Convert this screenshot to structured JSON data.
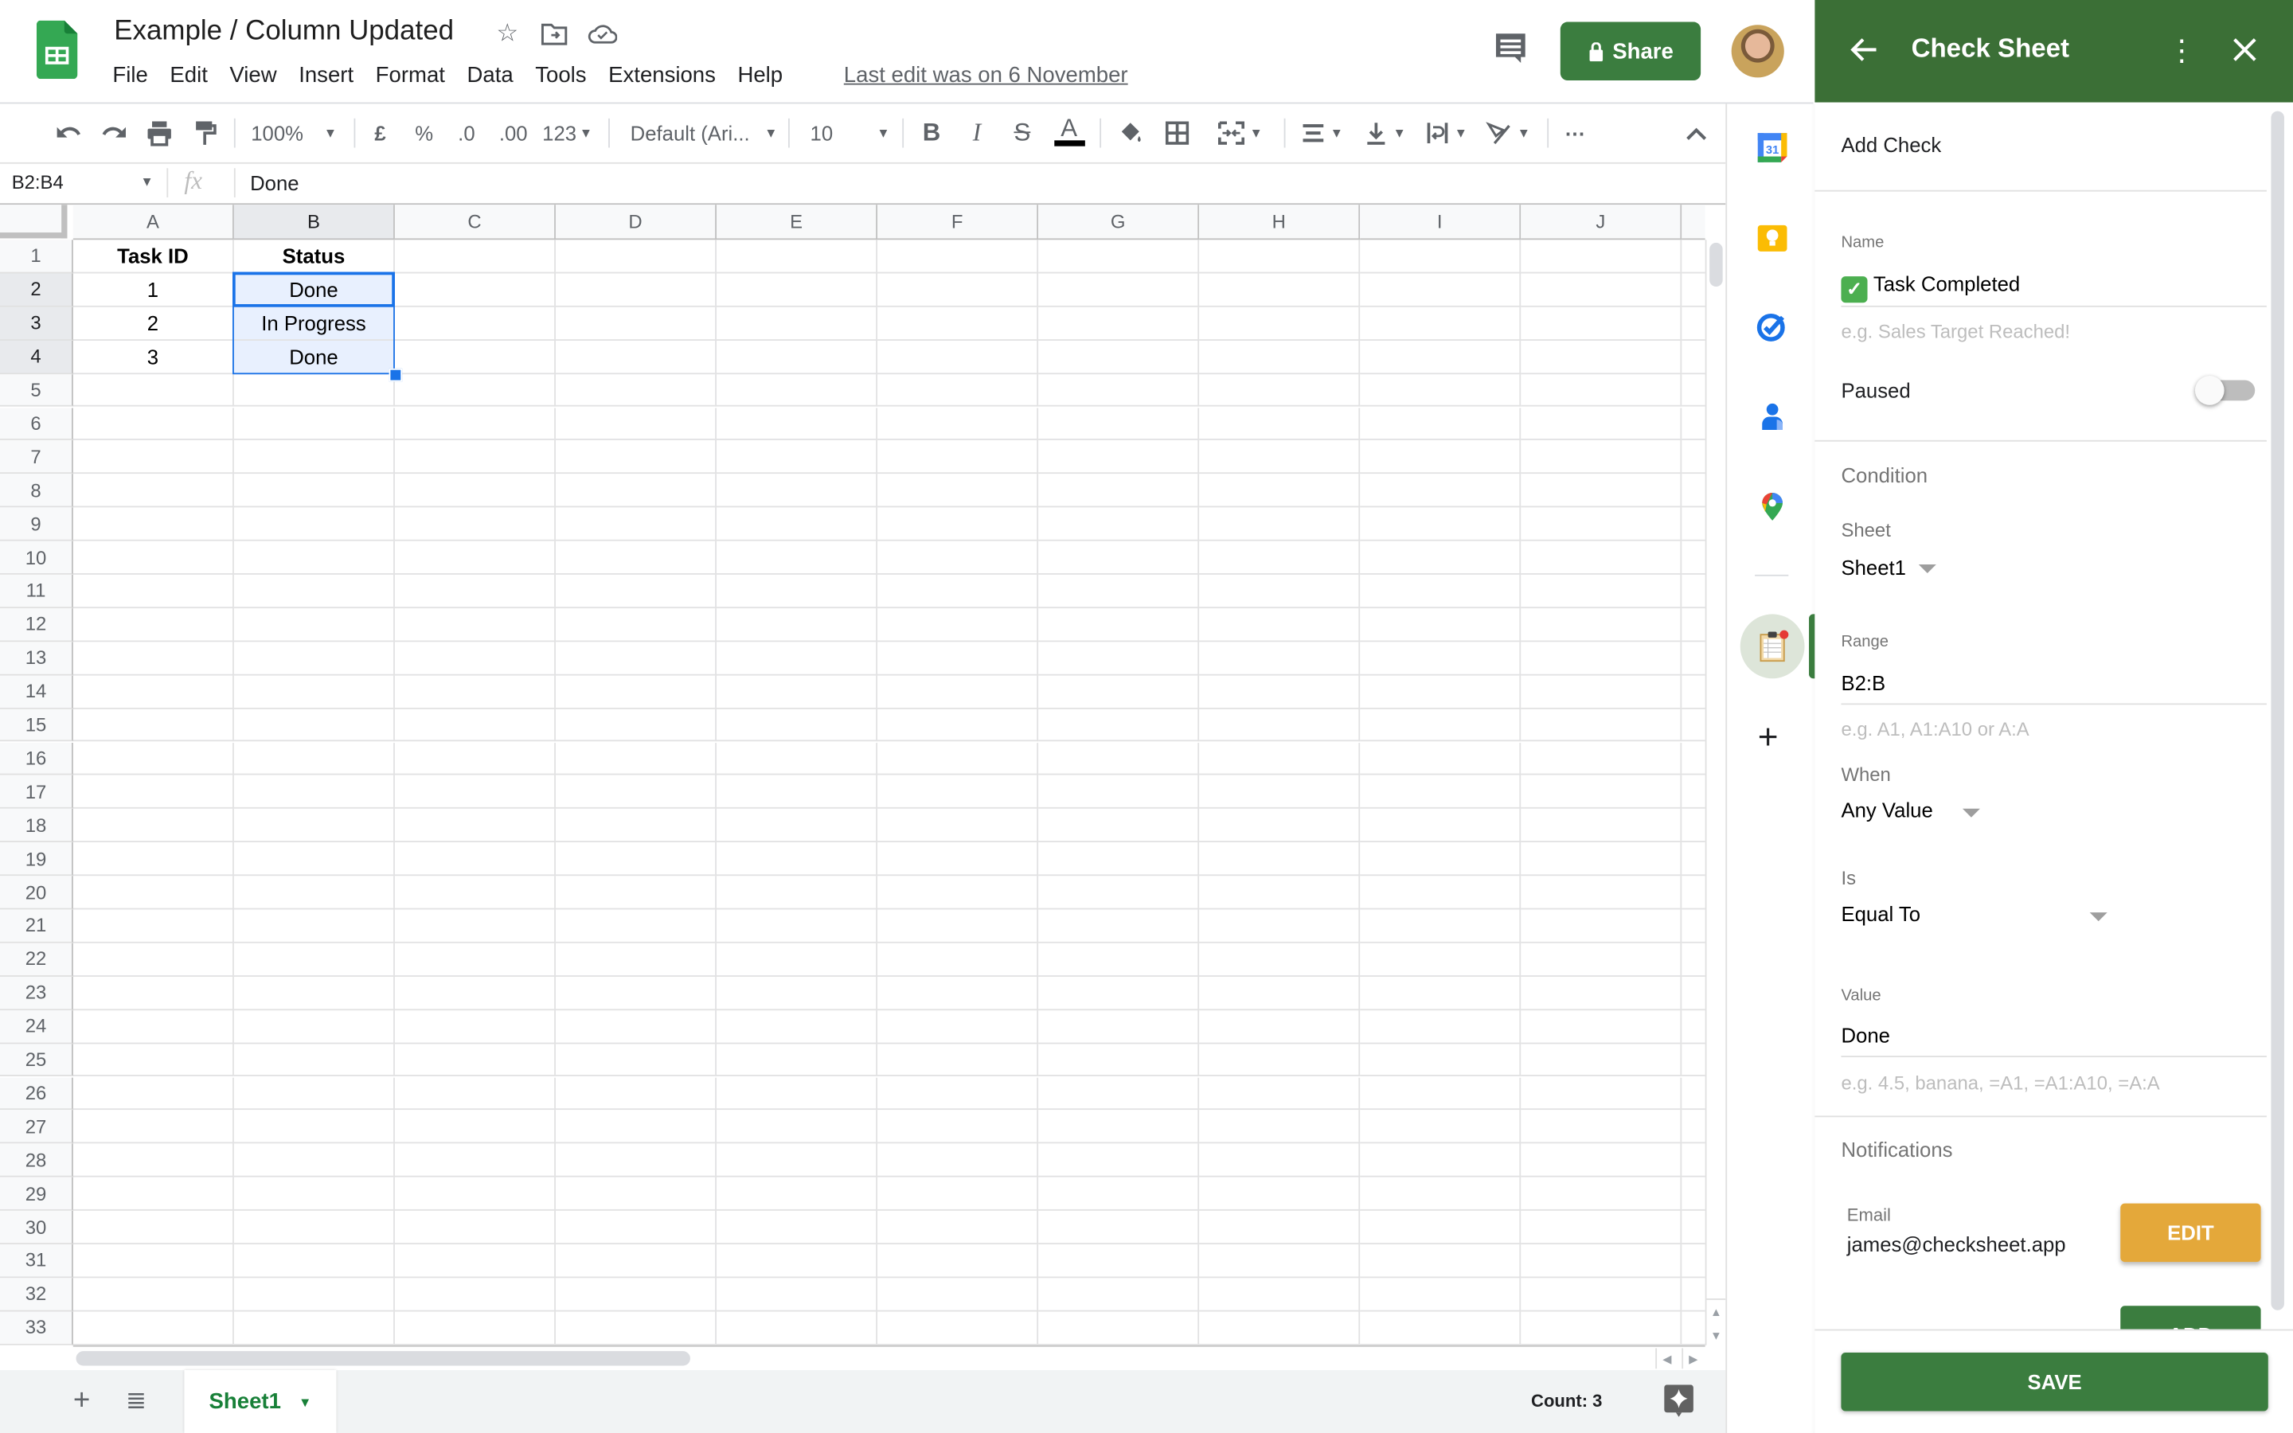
{
  "app": {
    "document_title": "Example / Column Updated",
    "menu": [
      "File",
      "Edit",
      "View",
      "Insert",
      "Format",
      "Data",
      "Tools",
      "Extensions",
      "Help"
    ],
    "last_edit": "Last edit was on 6 November",
    "share_label": "Share",
    "brand_color": "#3b7d3f"
  },
  "toolbar": {
    "zoom": "100%",
    "currency": "£",
    "percent": "%",
    "decrease_decimal": ".0",
    "increase_decimal": ".00",
    "number_format": "123",
    "font": "Default (Ari...",
    "font_size": "10",
    "bold": "B",
    "italic": "I",
    "strikethrough": "S",
    "text_color": "A",
    "more": "⋯"
  },
  "formula_bar": {
    "name_box": "B2:B4",
    "fx": "fx",
    "value": "Done"
  },
  "grid": {
    "columns": [
      "A",
      "B",
      "C",
      "D",
      "E",
      "F",
      "G",
      "H",
      "I",
      "J"
    ],
    "selected_column": "B",
    "row_count": 33,
    "selected_rows": [
      2,
      3,
      4
    ],
    "rows": [
      [
        "Task ID",
        "Status"
      ],
      [
        "1",
        "Done"
      ],
      [
        "2",
        "In Progress"
      ],
      [
        "3",
        "Done"
      ]
    ],
    "selection": "B2:B4"
  },
  "sheet_tabs": {
    "tabs": [
      "Sheet1"
    ],
    "active": "Sheet1",
    "count_summary": "Count: 3"
  },
  "side_rail": {
    "icons": [
      "google-calendar",
      "google-keep",
      "google-tasks",
      "google-contacts",
      "google-maps",
      "check-sheet-addon"
    ],
    "active": "check-sheet-addon",
    "badge": "1"
  },
  "panel": {
    "title": "Check Sheet",
    "section_title": "Add Check",
    "name_label": "Name",
    "name_emoji": "✓",
    "name_value": "Task Completed",
    "name_hint": "e.g. Sales Target Reached!",
    "paused_label": "Paused",
    "paused": false,
    "condition_title": "Condition",
    "sheet_label": "Sheet",
    "sheet_value": "Sheet1",
    "range_label": "Range",
    "range_value": "B2:B",
    "range_hint": "e.g. A1, A1:A10 or A:A",
    "when_label": "When",
    "when_value": "Any Value",
    "is_label": "Is",
    "is_value": "Equal To",
    "value_label": "Value",
    "value_value": "Done",
    "value_hint": "e.g. 4.5, banana, =A1, =A1:A10, =A:A",
    "notifications_title": "Notifications",
    "email_label": "Email",
    "email_value": "james@checksheet.app",
    "edit_label": "EDIT",
    "add_label": "ADD",
    "save_label": "SAVE",
    "header_color": "#3b6f36",
    "edit_color": "#e4a83a"
  }
}
